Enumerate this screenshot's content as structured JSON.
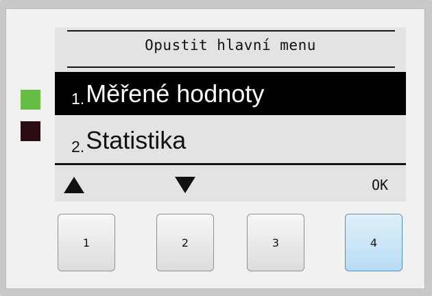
{
  "display": {
    "header": "Opustit hlavní menu",
    "items": [
      {
        "number": "1.",
        "label": "Měřené hodnoty",
        "selected": true
      },
      {
        "number": "2.",
        "label": "Statistika",
        "selected": false
      }
    ],
    "softkeys": {
      "up": "up-arrow",
      "down": "down-arrow",
      "ok": "OK"
    }
  },
  "indicators": {
    "green_led": "#66bf44",
    "dark_led": "#2a0c10"
  },
  "buttons": [
    {
      "label": "1"
    },
    {
      "label": "2"
    },
    {
      "label": "3"
    },
    {
      "label": "4",
      "active": true
    }
  ],
  "colors": {
    "selected_bg": "#000000",
    "selected_text": "#ffffff",
    "screen_bg": "#e3e3e3",
    "active_button": "#b8dcf3"
  }
}
